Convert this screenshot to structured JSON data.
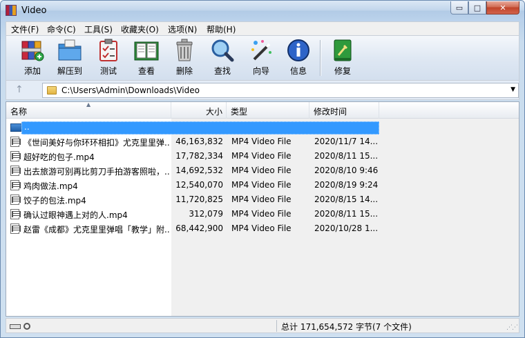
{
  "window": {
    "title": "Video",
    "buttons": {
      "minimize": "▭",
      "maximize": "□",
      "close": "✕"
    }
  },
  "menu": [
    "文件(F)",
    "命令(C)",
    "工具(S)",
    "收藏夹(O)",
    "选项(N)",
    "帮助(H)"
  ],
  "toolbar": {
    "buttons": [
      {
        "label": "添加",
        "icon": "add-books-icon"
      },
      {
        "label": "解压到",
        "icon": "extract-folder-icon"
      },
      {
        "label": "测试",
        "icon": "test-clipboard-icon"
      },
      {
        "label": "查看",
        "icon": "view-book-icon"
      },
      {
        "label": "删除",
        "icon": "trash-can-icon"
      },
      {
        "label": "查找",
        "icon": "magnifier-icon"
      },
      {
        "label": "向导",
        "icon": "wand-icon"
      },
      {
        "label": "信息",
        "icon": "info-icon"
      },
      {
        "label": "修复",
        "icon": "repair-kit-icon"
      }
    ]
  },
  "address": {
    "path": "C:\\Users\\Admin\\Downloads\\Video",
    "up_icon": "↑",
    "dropdown_icon": "▼"
  },
  "columns": {
    "name": "名称",
    "size": "大小",
    "type": "类型",
    "modified": "修改时间"
  },
  "parent_row": {
    "name": ".."
  },
  "files": [
    {
      "name": "《世间美好与你环环相扣》尤克里里弹...",
      "size": "46,163,832",
      "type": "MP4 Video File",
      "modified": "2020/11/7 14..."
    },
    {
      "name": "超好吃的包子.mp4",
      "size": "17,782,334",
      "type": "MP4 Video File",
      "modified": "2020/8/11 15..."
    },
    {
      "name": "出去旅游可别再比剪刀手拍游客照啦，...",
      "size": "14,692,532",
      "type": "MP4 Video File",
      "modified": "2020/8/10 9:46"
    },
    {
      "name": "鸡肉做法.mp4",
      "size": "12,540,070",
      "type": "MP4 Video File",
      "modified": "2020/8/19 9:24"
    },
    {
      "name": "饺子的包法.mp4",
      "size": "11,720,825",
      "type": "MP4 Video File",
      "modified": "2020/8/15 14..."
    },
    {
      "name": "确认过眼神遇上对的人.mp4",
      "size": "312,079",
      "type": "MP4 Video File",
      "modified": "2020/8/11 15..."
    },
    {
      "name": "赵雷《成都》尤克里里弹唱「教学」附...",
      "size": "68,442,900",
      "type": "MP4 Video File",
      "modified": "2020/10/28 1..."
    }
  ],
  "status": {
    "summary": "总计 171,654,572 字节(7 个文件)"
  }
}
